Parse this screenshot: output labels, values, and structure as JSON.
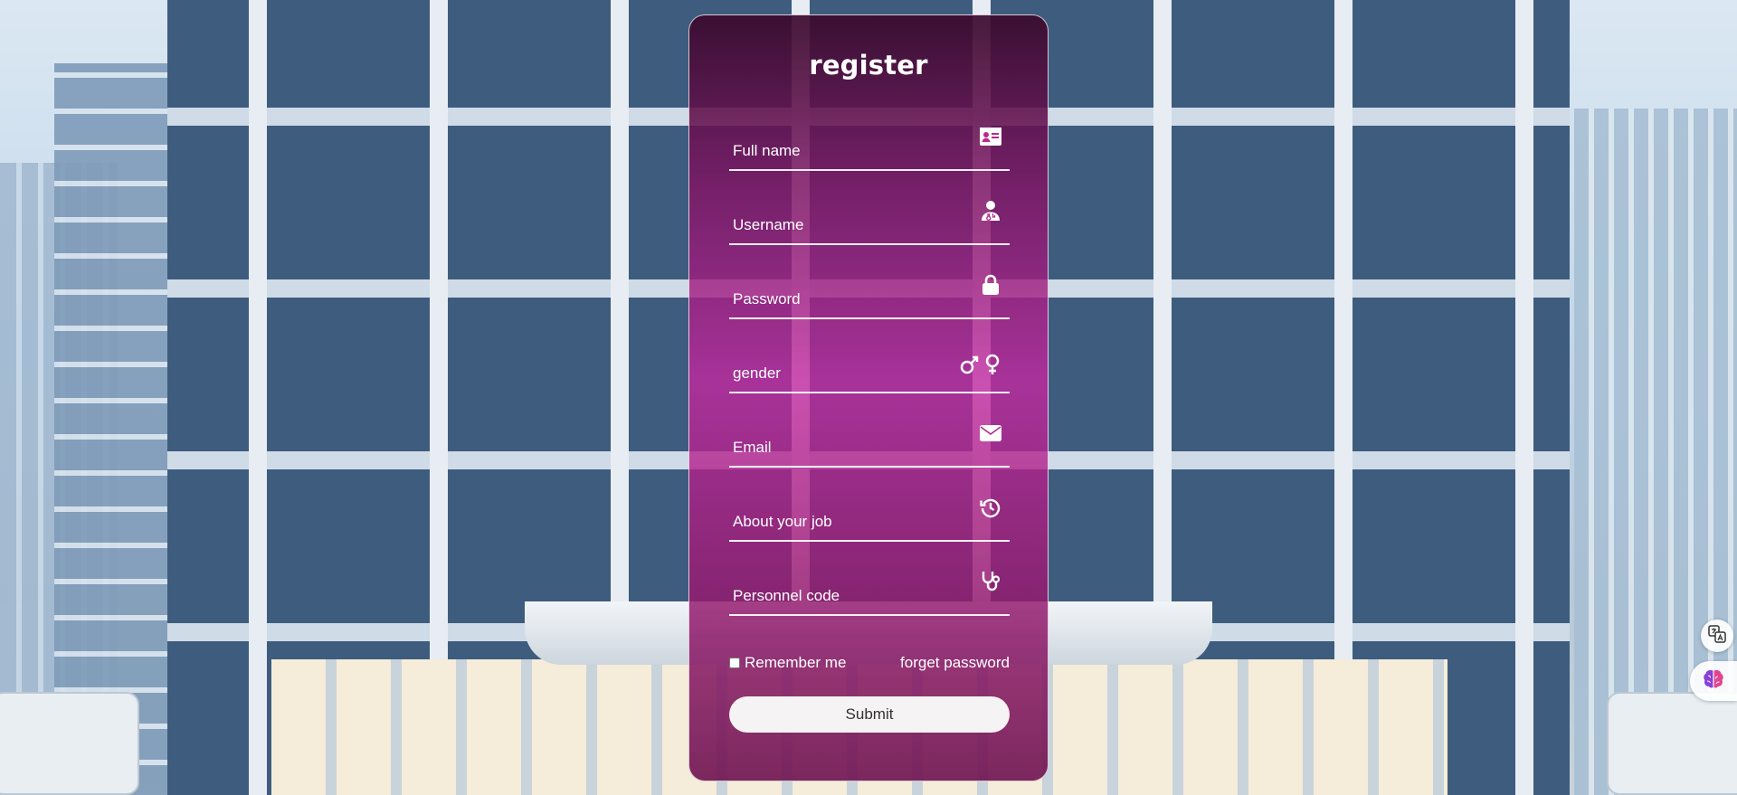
{
  "form": {
    "title": "register",
    "fields": [
      {
        "placeholder": "Full name",
        "icon": "id-card-icon"
      },
      {
        "placeholder": "Username",
        "icon": "user-doctor-icon"
      },
      {
        "placeholder": "Password",
        "icon": "lock-icon"
      },
      {
        "placeholder": "gender",
        "icon": "gender-icon"
      },
      {
        "placeholder": "Email",
        "icon": "envelope-icon"
      },
      {
        "placeholder": "About your job",
        "icon": "history-icon"
      },
      {
        "placeholder": "Personnel code",
        "icon": "stethoscope-icon"
      }
    ],
    "remember_label": "Remember me",
    "forgot_label": "forget password",
    "submit_label": "Submit"
  },
  "widgets": [
    "translate-icon",
    "brain-icon"
  ],
  "colors": {
    "card_top": "#3a0a2d",
    "card_mid": "#c328a0",
    "text": "#ffffff",
    "button_bg": "#f5f3f3"
  }
}
